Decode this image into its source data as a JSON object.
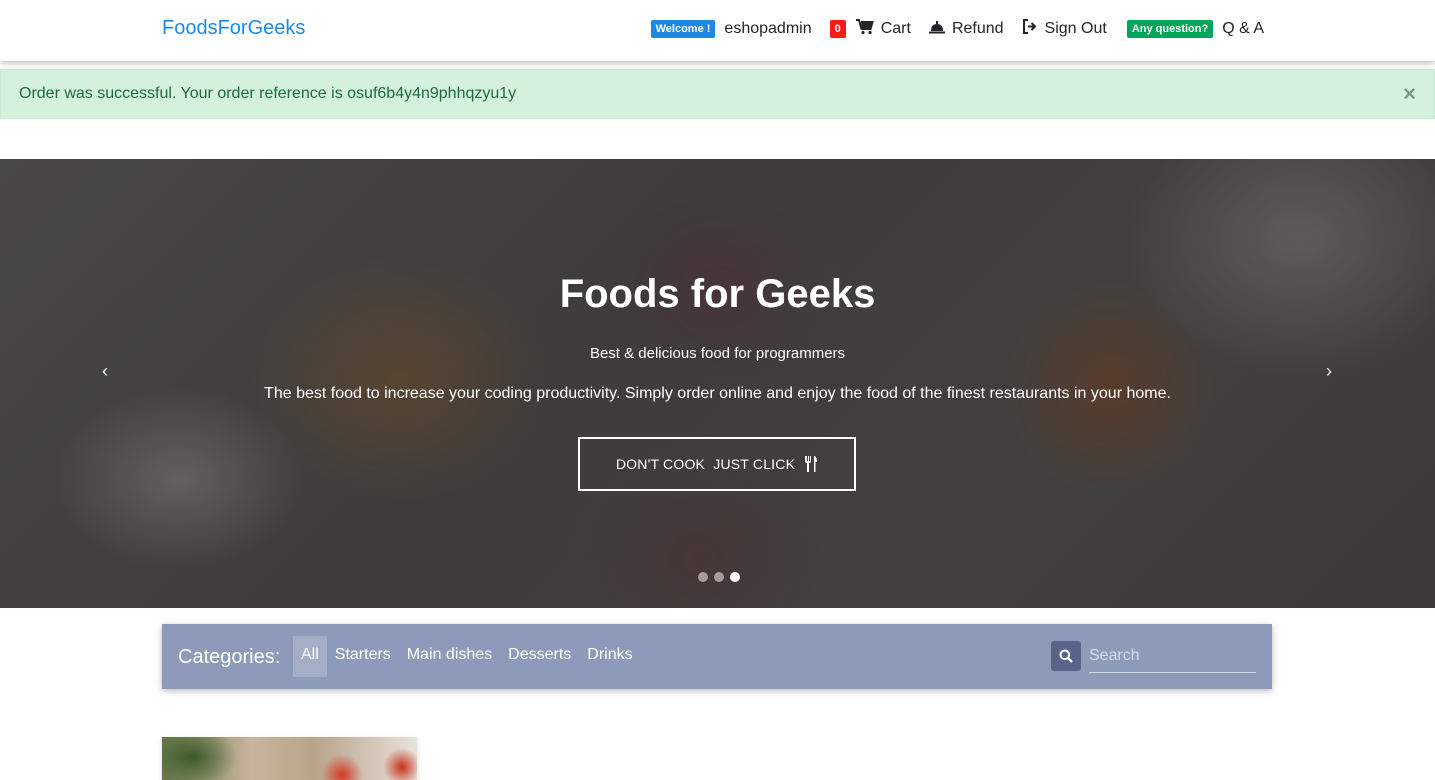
{
  "navbar": {
    "brand": "FoodsForGeeks",
    "welcome_badge": "Welcome !",
    "username": "eshopadmin",
    "cart_count": "0",
    "cart_label": "Cart",
    "refund_label": "Refund",
    "signout_label": "Sign Out",
    "question_badge": "Any question?",
    "qa_label": "Q & A"
  },
  "alert": {
    "message": "Order was successful. Your order reference is osuf6b4y4n9phhqzyu1y",
    "close": "×"
  },
  "carousel": {
    "title": "Foods for Geeks",
    "subtitle": "Best & delicious food for programmers",
    "description": "The best food to increase your coding productivity. Simply order online and enjoy the food of the finest restaurants in your home.",
    "cta_label": "DON'T COOK  JUST CLICK",
    "prev": "‹",
    "next": "›",
    "slide_count": 3,
    "active_slide": 3
  },
  "categories": {
    "label": "Categories:",
    "items": [
      "All",
      "Starters",
      "Main dishes",
      "Desserts",
      "Drinks"
    ],
    "active": "All",
    "search_placeholder": "Search"
  },
  "colors": {
    "brand": "#1e88e5",
    "category_bar": "#8e9ab9",
    "alert_bg": "#d4f1dd",
    "badge_red": "#ff1a1a",
    "badge_green": "#00a65a"
  }
}
